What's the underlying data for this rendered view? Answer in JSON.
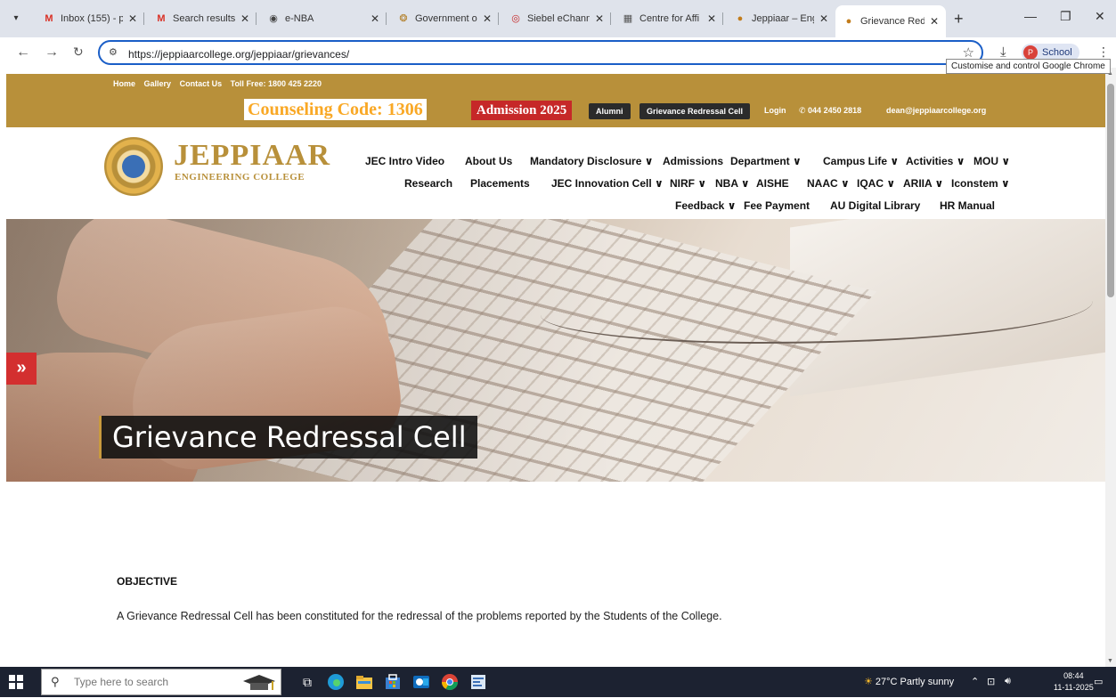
{
  "browser": {
    "tabs": [
      {
        "title": "Inbox (155) - p",
        "favicon": "gmail-icon"
      },
      {
        "title": "Search results",
        "favicon": "gmail-icon"
      },
      {
        "title": "e-NBA",
        "favicon": "globe-icon"
      },
      {
        "title": "Government o",
        "favicon": "emblem-icon"
      },
      {
        "title": "Siebel eChann",
        "favicon": "siebel-icon"
      },
      {
        "title": "Centre for Affi",
        "favicon": "building-icon"
      },
      {
        "title": "Jeppiaar – Eng",
        "favicon": "college-icon"
      },
      {
        "title": "Grievance Red",
        "favicon": "college-icon",
        "active": true
      }
    ],
    "url": "https://jeppiaarcollege.org/jeppiaar/grievances/",
    "profile_label": "School",
    "profile_initial": "P",
    "tooltip": "Customise and control Google Chrome"
  },
  "site": {
    "top_links": [
      "Home",
      "Gallery",
      "Contact Us",
      "Toll Free: 1800 425 2220"
    ],
    "counseling_code": "Counseling Code: 1306",
    "admission": "Admission 2025",
    "alumni_btn": "Alumni",
    "grievance_btn": "Grievance Redressal Cell",
    "login": "Login",
    "phone": "044 2450 2818",
    "email": "dean@jeppiaarcollege.org",
    "logo_name": "JEPPIAAR",
    "logo_sub": "ENGINEERING COLLEGE",
    "nav_row1": [
      "JEC Intro Video",
      "About Us",
      "Mandatory Disclosure ∨",
      "Admissions",
      "Department ∨",
      "Campus Life ∨",
      "Activities ∨",
      "MOU ∨"
    ],
    "nav_row2": [
      "Research",
      "Placements",
      "JEC Innovation Cell ∨",
      "NIRF ∨",
      "NBA ∨",
      "AISHE",
      "NAAC ∨",
      "IQAC ∨",
      "ARIIA ∨",
      "Iconstem ∨"
    ],
    "nav_row3": [
      "Feedback ∨",
      "Fee Payment",
      "AU Digital Library",
      "HR Manual"
    ],
    "banner_title": "Grievance Redressal Cell",
    "side_arrow": "»",
    "objective_heading": "OBJECTIVE",
    "objective_text": "A Grievance Redressal Cell has been constituted for the redressal of the problems reported by the Students of the College."
  },
  "taskbar": {
    "search_placeholder": "Type here to search",
    "weather": "27°C  Partly sunny",
    "time": "08:44",
    "date": "11-11-2025"
  }
}
